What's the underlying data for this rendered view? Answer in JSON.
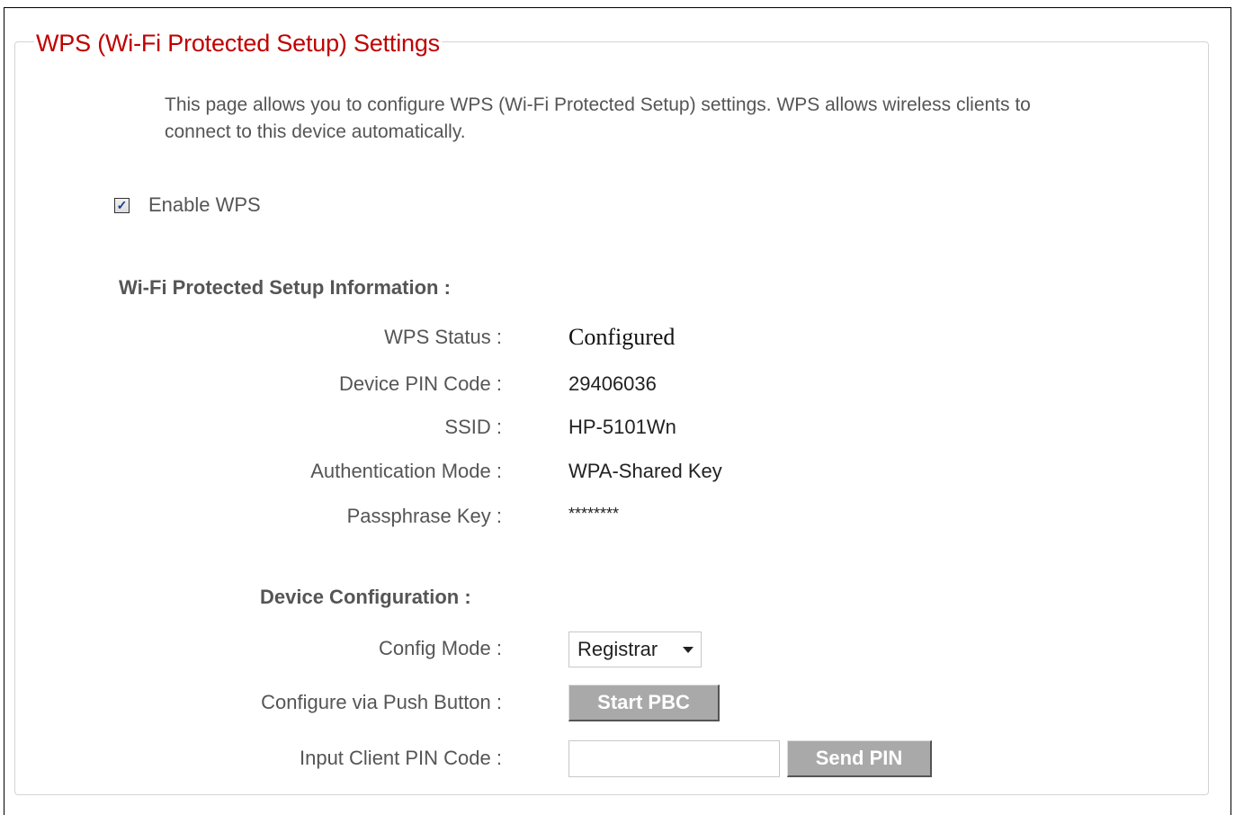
{
  "title": "WPS (Wi-Fi Protected Setup) Settings",
  "description": "This page allows you to configure WPS (Wi-Fi Protected Setup) settings. WPS allows wireless clients to connect to this device automatically.",
  "enable_wps": {
    "label": "Enable WPS",
    "checked": true
  },
  "info_section": {
    "heading": "Wi-Fi Protected Setup Information :",
    "rows": [
      {
        "label": "WPS Status :",
        "value": "Configured"
      },
      {
        "label": "Device PIN Code :",
        "value": "29406036"
      },
      {
        "label": "SSID :",
        "value": "HP-5101Wn"
      },
      {
        "label": "Authentication Mode :",
        "value": "WPA-Shared Key"
      },
      {
        "label": "Passphrase Key :",
        "value": "********"
      }
    ]
  },
  "config_section": {
    "heading": "Device Configuration :",
    "config_mode": {
      "label": "Config Mode :",
      "selected": "Registrar"
    },
    "push_button": {
      "label": "Configure via Push Button :",
      "button": "Start PBC"
    },
    "client_pin": {
      "label": "Input Client PIN Code :",
      "value": "",
      "button": "Send PIN"
    }
  },
  "colors": {
    "title": "#c00000",
    "button_bg": "#a9a9a9"
  }
}
